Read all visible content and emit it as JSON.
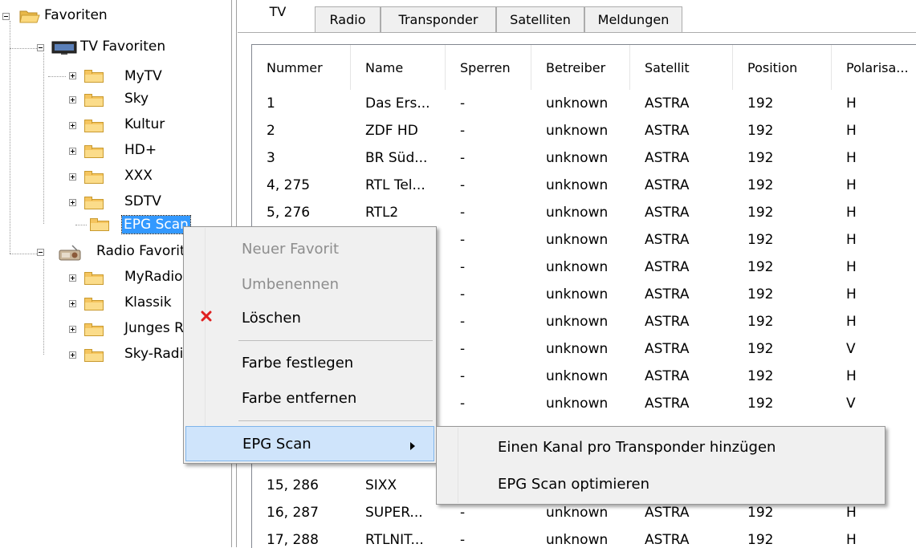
{
  "tree": {
    "root": "Favoriten",
    "tv_favorites": "TV Favoriten",
    "tv_items": [
      "MyTV",
      "Sky",
      "Kultur",
      "HD+",
      "XXX",
      "SDTV",
      "EPG Scan"
    ],
    "radio_favorites": "Radio Favoriten",
    "radio_items": [
      "MyRadio",
      "Klassik",
      "Junges Radio",
      "Sky-Radio"
    ]
  },
  "tabs": [
    "TV",
    "Radio",
    "Transponder",
    "Satelliten",
    "Meldungen"
  ],
  "table": {
    "columns": [
      "Nummer",
      "Name",
      "Sperren",
      "Betreiber",
      "Satellit",
      "Position",
      "Polarisa..."
    ],
    "rows": [
      [
        "1",
        "Das Ers...",
        "-",
        "unknown",
        "ASTRA",
        "192",
        "H"
      ],
      [
        "2",
        "ZDF HD",
        "-",
        "unknown",
        "ASTRA",
        "192",
        "H"
      ],
      [
        "3",
        "BR Süd...",
        "-",
        "unknown",
        "ASTRA",
        "192",
        "H"
      ],
      [
        "4, 275",
        "RTL Tel...",
        "-",
        "unknown",
        "ASTRA",
        "192",
        "H"
      ],
      [
        "5, 276",
        "RTL2",
        "-",
        "unknown",
        "ASTRA",
        "192",
        "H"
      ],
      [
        "",
        "",
        "-",
        "unknown",
        "ASTRA",
        "192",
        "H"
      ],
      [
        "",
        "",
        "-",
        "unknown",
        "ASTRA",
        "192",
        "H"
      ],
      [
        "",
        "",
        "-",
        "unknown",
        "ASTRA",
        "192",
        "H"
      ],
      [
        "",
        "",
        "-",
        "unknown",
        "ASTRA",
        "192",
        "H"
      ],
      [
        "",
        "",
        "-",
        "unknown",
        "ASTRA",
        "192",
        "V"
      ],
      [
        "",
        "",
        "-",
        "unknown",
        "ASTRA",
        "192",
        "H"
      ],
      [
        "",
        "",
        "-",
        "unknown",
        "ASTRA",
        "192",
        "V"
      ],
      [
        "",
        "",
        "",
        "",
        "",
        "",
        ""
      ],
      [
        "",
        "",
        "",
        "",
        "",
        "",
        ""
      ],
      [
        "15, 286",
        "SIXX",
        "",
        "",
        "",
        "",
        ""
      ],
      [
        "16, 287",
        "SUPER...",
        "-",
        "unknown",
        "ASTRA",
        "192",
        "H"
      ],
      [
        "17, 288",
        "RTLNIT...",
        "-",
        "unknown",
        "ASTRA",
        "192",
        "H"
      ]
    ]
  },
  "context_menu": {
    "items": [
      {
        "label": "Neuer Favorit",
        "disabled": true
      },
      {
        "label": "Umbenennen",
        "disabled": true
      },
      {
        "label": "Löschen",
        "disabled": false,
        "icon": "red-x-icon"
      },
      {
        "label": "Farbe festlegen",
        "disabled": false
      },
      {
        "label": "Farbe entfernen",
        "disabled": false
      },
      {
        "label": "EPG Scan",
        "disabled": false,
        "submenu": true
      }
    ],
    "submenu": [
      "Einen Kanal pro Transponder hinzügen",
      "EPG Scan optimieren"
    ]
  },
  "colors": {
    "selection": "#3399ff",
    "menu_highlight": "#cfe4fb",
    "delete_icon": "#e02020"
  }
}
